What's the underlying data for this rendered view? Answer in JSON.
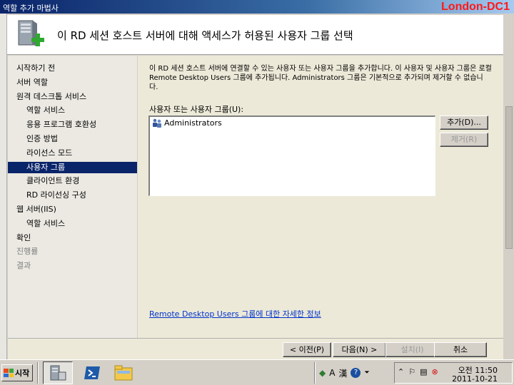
{
  "window": {
    "title": "역할 추가 마법사",
    "server_name": "London-DC1"
  },
  "header": {
    "heading": "이 RD 세션 호스트 서버에 대해 액세스가 허용된 사용자 그룹 선택"
  },
  "nav": {
    "items": [
      {
        "label": "시작하기 전",
        "sub": false,
        "state": "normal"
      },
      {
        "label": "서버 역할",
        "sub": false,
        "state": "normal"
      },
      {
        "label": "원격 데스크톱 서비스",
        "sub": false,
        "state": "normal"
      },
      {
        "label": "역할 서비스",
        "sub": true,
        "state": "normal"
      },
      {
        "label": "응용 프로그램 호환성",
        "sub": true,
        "state": "normal"
      },
      {
        "label": "인증 방법",
        "sub": true,
        "state": "normal"
      },
      {
        "label": "라이선스 모드",
        "sub": true,
        "state": "normal"
      },
      {
        "label": "사용자 그룹",
        "sub": true,
        "state": "active"
      },
      {
        "label": "클라이언트 환경",
        "sub": true,
        "state": "normal"
      },
      {
        "label": "RD 라이선싱 구성",
        "sub": true,
        "state": "normal"
      },
      {
        "label": "웹 서버(IIS)",
        "sub": false,
        "state": "normal"
      },
      {
        "label": "역할 서비스",
        "sub": true,
        "state": "normal"
      },
      {
        "label": "확인",
        "sub": false,
        "state": "normal"
      },
      {
        "label": "진행률",
        "sub": false,
        "state": "dim"
      },
      {
        "label": "결과",
        "sub": false,
        "state": "dim"
      }
    ]
  },
  "content": {
    "description": "이 RD 세션 호스트 서버에 연결할 수 있는 사용자 또는 사용자 그룹을 추가합니다. 이 사용자 및 사용자 그룹은 로컬 Remote Desktop Users 그룹에 추가됩니다. Administrators 그룹은 기본적으로 추가되며 제거할 수 없습니다.",
    "list_label": "사용자 또는 사용자 그룹(U):",
    "list_items": [
      "Administrators"
    ],
    "add_button": "추가(D)...",
    "remove_button": "제거(R)",
    "more_info_link": "Remote Desktop Users 그룹에 대한 자세한 정보"
  },
  "footer": {
    "prev_button": "< 이전(P)",
    "next_button": "다음(N) >",
    "install_button": "설치(I)",
    "cancel_button": "취소"
  },
  "taskbar": {
    "start_label": "시작",
    "ime_a": "A",
    "ime_han": "漢",
    "clock_time": "오전 11:50",
    "clock_date": "2011-10-21"
  },
  "colors": {
    "title_bar": "#0a246a",
    "nav_active": "#0a246a",
    "server_name": "#ff1a1a",
    "link": "#0033cc"
  }
}
